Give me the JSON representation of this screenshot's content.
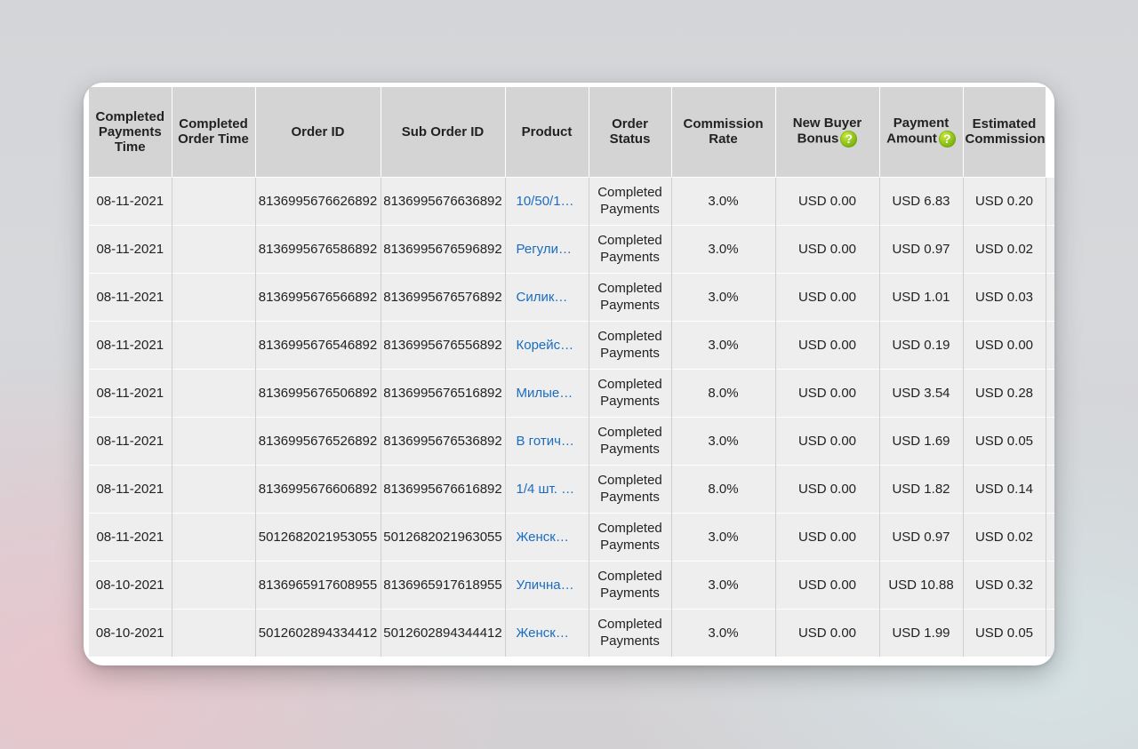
{
  "table": {
    "headers": {
      "completed_payments_time": "Completed Payments Time",
      "completed_order_time": "Completed Order Time",
      "order_id": "Order ID",
      "sub_order_id": "Sub Order ID",
      "product": "Product",
      "order_status": "Order Status",
      "commission_rate": "Commission Rate",
      "new_buyer_bonus": "New Buyer Bonus",
      "payment_amount": "Payment Amount",
      "estimated_commission": "Estimated Commission"
    },
    "help_glyph": "?",
    "rows": [
      {
        "payment_time": "08-11-2021",
        "order_time": "",
        "order_id": "8136995676626892",
        "sub_order_id": "8136995676636892",
        "product": "10/50/1…",
        "status": "Completed Payments",
        "rate": "3.0%",
        "bonus": "USD 0.00",
        "amount": "USD 6.83",
        "commission": "USD 0.20"
      },
      {
        "payment_time": "08-11-2021",
        "order_time": "",
        "order_id": "8136995676586892",
        "sub_order_id": "8136995676596892",
        "product": "Регули…",
        "status": "Completed Payments",
        "rate": "3.0%",
        "bonus": "USD 0.00",
        "amount": "USD 0.97",
        "commission": "USD 0.02"
      },
      {
        "payment_time": "08-11-2021",
        "order_time": "",
        "order_id": "8136995676566892",
        "sub_order_id": "8136995676576892",
        "product": "Силик…",
        "status": "Completed Payments",
        "rate": "3.0%",
        "bonus": "USD 0.00",
        "amount": "USD 1.01",
        "commission": "USD 0.03"
      },
      {
        "payment_time": "08-11-2021",
        "order_time": "",
        "order_id": "8136995676546892",
        "sub_order_id": "8136995676556892",
        "product": "Корейс…",
        "status": "Completed Payments",
        "rate": "3.0%",
        "bonus": "USD 0.00",
        "amount": "USD 0.19",
        "commission": "USD 0.00"
      },
      {
        "payment_time": "08-11-2021",
        "order_time": "",
        "order_id": "8136995676506892",
        "sub_order_id": "8136995676516892",
        "product": "Милые…",
        "status": "Completed Payments",
        "rate": "8.0%",
        "bonus": "USD 0.00",
        "amount": "USD 3.54",
        "commission": "USD 0.28"
      },
      {
        "payment_time": "08-11-2021",
        "order_time": "",
        "order_id": "8136995676526892",
        "sub_order_id": "8136995676536892",
        "product": "В готич…",
        "status": "Completed Payments",
        "rate": "3.0%",
        "bonus": "USD 0.00",
        "amount": "USD 1.69",
        "commission": "USD 0.05"
      },
      {
        "payment_time": "08-11-2021",
        "order_time": "",
        "order_id": "8136995676606892",
        "sub_order_id": "8136995676616892",
        "product": "1/4 шт. …",
        "status": "Completed Payments",
        "rate": "8.0%",
        "bonus": "USD 0.00",
        "amount": "USD 1.82",
        "commission": "USD 0.14"
      },
      {
        "payment_time": "08-11-2021",
        "order_time": "",
        "order_id": "5012682021953055",
        "sub_order_id": "5012682021963055",
        "product": "Женск…",
        "status": "Completed Payments",
        "rate": "3.0%",
        "bonus": "USD 0.00",
        "amount": "USD 0.97",
        "commission": "USD 0.02"
      },
      {
        "payment_time": "08-10-2021",
        "order_time": "",
        "order_id": "8136965917608955",
        "sub_order_id": "8136965917618955",
        "product": "Улична…",
        "status": "Completed Payments",
        "rate": "3.0%",
        "bonus": "USD 0.00",
        "amount": "USD 10.88",
        "commission": "USD 0.32"
      },
      {
        "payment_time": "08-10-2021",
        "order_time": "",
        "order_id": "5012602894334412",
        "sub_order_id": "5012602894344412",
        "product": "Женск…",
        "status": "Completed Payments",
        "rate": "3.0%",
        "bonus": "USD 0.00",
        "amount": "USD 1.99",
        "commission": "USD 0.05"
      }
    ]
  }
}
